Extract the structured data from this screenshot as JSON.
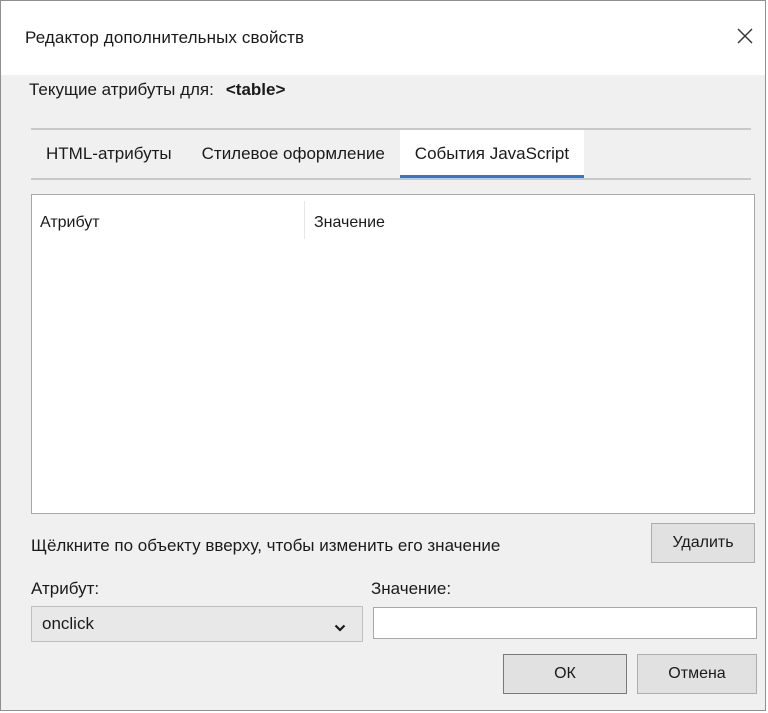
{
  "window": {
    "title": "Редактор дополнительных свойств",
    "close_icon": "close-icon"
  },
  "current_attributes": {
    "label": "Текущие атрибуты для:",
    "tag": "<table>"
  },
  "tabs": [
    {
      "label": "HTML-атрибуты",
      "active": false
    },
    {
      "label": "Стилевое оформление",
      "active": false
    },
    {
      "label": "События JavaScript",
      "active": true
    }
  ],
  "table": {
    "columns": [
      "Атрибут",
      "Значение"
    ],
    "rows": []
  },
  "hint": "Щёлкните по объекту вверху, чтобы изменить его значение",
  "buttons": {
    "delete": "Удалить",
    "ok": "ОК",
    "cancel": "Отмена"
  },
  "form": {
    "attribute_label": "Атрибут:",
    "attribute_value": "onclick",
    "value_label": "Значение:",
    "value_input": ""
  },
  "colors": {
    "active_tab_underline": "#2b7bd6",
    "dialog_bg": "#f0f0f0"
  }
}
